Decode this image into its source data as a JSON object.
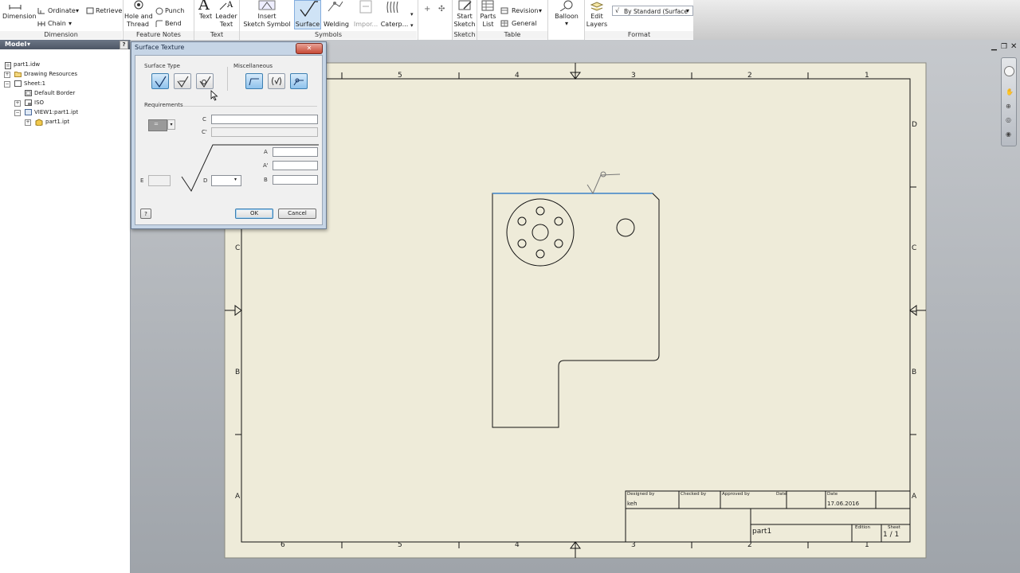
{
  "ribbon": {
    "dimension": {
      "label": "Dimension",
      "ordinate": "Ordinate",
      "chain": "Chain",
      "retrieve": "Retrieve",
      "group": "Dimension"
    },
    "feature_notes": {
      "hole_thread_1": "Hole and",
      "hole_thread_2": "Thread",
      "punch": "Punch",
      "bend": "Bend",
      "group": "Feature Notes"
    },
    "text": {
      "text": "Text",
      "leader_1": "Leader",
      "leader_2": "Text",
      "group": "Text"
    },
    "symbols": {
      "insert_1": "Insert",
      "insert_2": "Sketch Symbol",
      "surface": "Surface",
      "welding": "Welding",
      "import": "Impor...",
      "caterpillar": "Caterp...",
      "group": "Symbols"
    },
    "sketch": {
      "start_1": "Start",
      "start_2": "Sketch",
      "group": "Sketch"
    },
    "table": {
      "parts_1": "Parts",
      "parts_2": "List",
      "revision": "Revision",
      "general": "General",
      "group": "Table"
    },
    "balloon": {
      "label": "Balloon"
    },
    "format": {
      "edit_1": "Edit",
      "edit_2": "Layers",
      "style": "By Standard (Surface",
      "group": "Format"
    }
  },
  "browser": {
    "header": "Model",
    "nodes": [
      "part1.idw",
      "Drawing Resources",
      "Sheet:1",
      "Default Border",
      "ISO",
      "VIEW1:part1.ipt",
      "part1.ipt"
    ]
  },
  "dialog": {
    "title": "Surface Texture",
    "surface_type_label": "Surface Type",
    "misc_label": "Miscellaneous",
    "requirements_label": "Requirements",
    "lay_value": "=",
    "fields": {
      "c": "C",
      "c_prime": "C'",
      "a": "A",
      "a_prime": "A'",
      "b": "B",
      "d": "D",
      "e": "E"
    },
    "ok": "OK",
    "cancel": "Cancel",
    "help": "?"
  },
  "sheet": {
    "cols_top": [
      "5",
      "4",
      "3",
      "2",
      "1"
    ],
    "cols_bottom": [
      "6",
      "5",
      "4",
      "3",
      "2",
      "1"
    ],
    "rows": [
      "D",
      "C",
      "B",
      "A"
    ],
    "title_block": {
      "designed_by_label": "Designed by",
      "designed_by": "keh",
      "checked_by_label": "Checked by",
      "approved_by_label": "Approved by",
      "date_label_1": "Date",
      "date_label_2": "Date",
      "date": "17.06.2016",
      "name": "part1",
      "edition_label": "Edition",
      "sheet_label": "Sheet",
      "sheet_value": "1 / 1"
    }
  },
  "colors": {
    "paper": "#eeebd9",
    "highlight": "#3c82c8",
    "ribbon_active": "#cfe3f6"
  }
}
